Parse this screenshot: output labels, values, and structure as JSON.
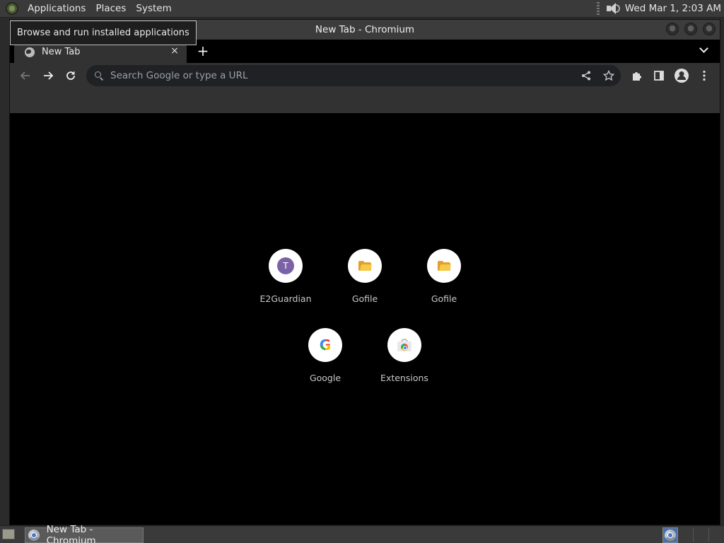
{
  "top_panel": {
    "menus": [
      "Applications",
      "Places",
      "System"
    ],
    "clock": "Wed Mar  1,  2:03 AM"
  },
  "tooltip": "Browse and run installed applications",
  "window": {
    "title": "New Tab - Chromium"
  },
  "tab": {
    "label": "New Tab",
    "close_symbol": "×",
    "new_tab_symbol": "+"
  },
  "omnibox": {
    "placeholder": "Search Google or type a URL"
  },
  "shortcuts": [
    {
      "label": "E2Guardian",
      "icon": "letter-icon",
      "letter": "T"
    },
    {
      "label": "Gofile",
      "icon": "folder-icon"
    },
    {
      "label": "Gofile",
      "icon": "folder-icon"
    },
    {
      "label": "Google",
      "icon": "google-icon",
      "letter": "G"
    },
    {
      "label": "Extensions",
      "icon": "chrome-web-store-icon"
    }
  ],
  "taskbar": {
    "window_button": "New Tab - Chromium"
  },
  "colors": {
    "panel_bg": "#3a3a3a",
    "toolbar_bg": "#323232",
    "content_bg": "#000000",
    "letter_avatar": "#7b62a6"
  }
}
